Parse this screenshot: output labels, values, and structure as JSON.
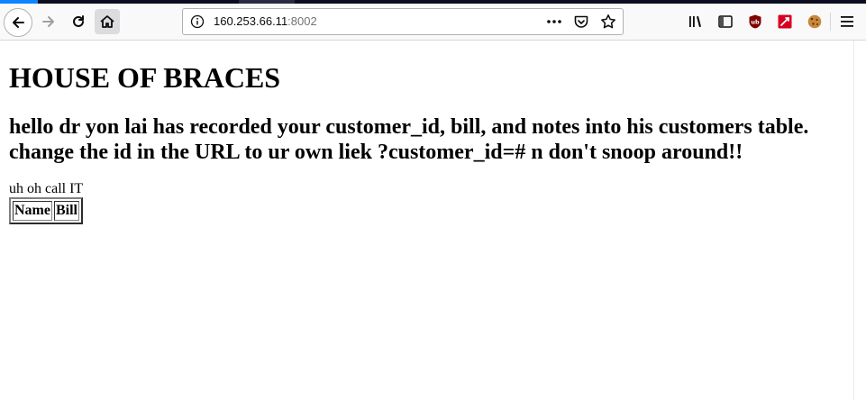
{
  "browser": {
    "url_host": "160.253.66.11",
    "url_port": ":8002",
    "icons": {
      "back": "back-arrow-icon",
      "forward": "forward-arrow-icon",
      "reload": "reload-icon",
      "home": "home-icon",
      "site_info": "info-icon",
      "page_actions": "more-icon",
      "pocket": "pocket-icon",
      "bookmark": "star-icon",
      "library": "library-icon",
      "sidebar": "sidebar-icon",
      "ublock": "ublock-origin-icon",
      "extension_red": "red-extension-icon",
      "cookie": "cookie-icon",
      "menu": "hamburger-menu-icon"
    },
    "colors": {
      "accent": "#0a84ff",
      "ublock": "#800000",
      "ext_red": "#d70022"
    }
  },
  "page": {
    "heading": "HOUSE OF BRACES",
    "subheading": "hello dr yon lai has recorded your customer_id, bill, and notes into his customers table. change the id in the URL to ur own liek ?customer_id=# n don't snoop around!!",
    "status_text": "uh oh call IT",
    "table": {
      "headers": [
        "Name",
        "Bill"
      ]
    }
  }
}
